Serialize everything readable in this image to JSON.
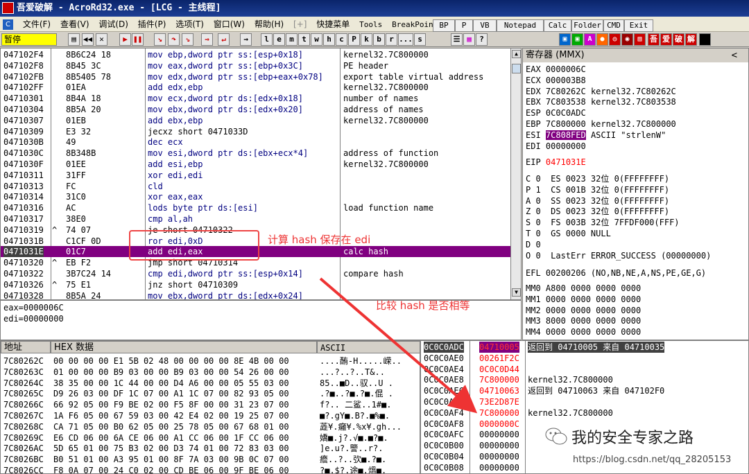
{
  "title": "吾爱破解 - AcroRd32.exe - [LCG - 主线程]",
  "menu": [
    "文件(F)",
    "查看(V)",
    "调试(D)",
    "插件(P)",
    "选项(T)",
    "窗口(W)",
    "帮助(H)",
    "[+]",
    "快捷菜单",
    "Tools",
    "BreakPoint->"
  ],
  "menu_buttons": [
    "BP",
    "P",
    "VB",
    "Notepad",
    "Calc",
    "Folder",
    "CMD",
    "Exit"
  ],
  "status": "暂停",
  "toolbar_letters": [
    "l",
    "e",
    "m",
    "t",
    "w",
    "h",
    "c",
    "P",
    "k",
    "b",
    "r",
    "...",
    "s"
  ],
  "toolbar_right": [
    "吾",
    "爱",
    "破",
    "解"
  ],
  "disasm": [
    {
      "addr": "047102F4",
      "bytes": "8B6C24 18",
      "arrow": "",
      "instr": "mov ebp,dword ptr ss:[esp+0x18]",
      "comment": "kernel32.7C800000",
      "kind": "normal"
    },
    {
      "addr": "047102F8",
      "bytes": "8B45 3C",
      "arrow": "",
      "instr": "mov eax,dword ptr ss:[ebp+0x3C]",
      "comment": "PE header",
      "kind": "normal"
    },
    {
      "addr": "047102FB",
      "bytes": "8B5405 78",
      "arrow": "",
      "instr": "mov edx,dword ptr ss:[ebp+eax+0x78]",
      "comment": "export table virtual address",
      "kind": "normal"
    },
    {
      "addr": "047102FF",
      "bytes": "01EA",
      "arrow": "",
      "instr": "add edx,ebp",
      "comment": "kernel32.7C800000",
      "kind": "normal"
    },
    {
      "addr": "04710301",
      "bytes": "8B4A 18",
      "arrow": "",
      "instr": "mov ecx,dword ptr ds:[edx+0x18]",
      "comment": "number of names",
      "kind": "normal"
    },
    {
      "addr": "04710304",
      "bytes": "8B5A 20",
      "arrow": "",
      "instr": "mov ebx,dword ptr ds:[edx+0x20]",
      "comment": "address of names",
      "kind": "normal"
    },
    {
      "addr": "04710307",
      "bytes": "01EB",
      "arrow": "",
      "instr": "add ebx,ebp",
      "comment": "kernel32.7C800000",
      "kind": "normal"
    },
    {
      "addr": "04710309",
      "bytes": "E3 32",
      "arrow": "",
      "instr": "jecxz short 0471033D",
      "comment": "",
      "kind": "jmp"
    },
    {
      "addr": "0471030B",
      "bytes": "49",
      "arrow": "",
      "instr": "dec ecx",
      "comment": "",
      "kind": "normal"
    },
    {
      "addr": "0471030C",
      "bytes": "8B348B",
      "arrow": "",
      "instr": "mov esi,dword ptr ds:[ebx+ecx*4]",
      "comment": "address of function",
      "kind": "normal"
    },
    {
      "addr": "0471030F",
      "bytes": "01EE",
      "arrow": "",
      "instr": "add esi,ebp",
      "comment": "kernel32.7C800000",
      "kind": "normal"
    },
    {
      "addr": "04710311",
      "bytes": "31FF",
      "arrow": "",
      "instr": "xor edi,edi",
      "comment": "",
      "kind": "normal"
    },
    {
      "addr": "04710313",
      "bytes": "FC",
      "arrow": "",
      "instr": "cld",
      "comment": "",
      "kind": "normal"
    },
    {
      "addr": "04710314",
      "bytes": "31C0",
      "arrow": "",
      "instr": "xor eax,eax",
      "comment": "",
      "kind": "normal"
    },
    {
      "addr": "04710316",
      "bytes": "AC",
      "arrow": "",
      "instr": "lods byte ptr ds:[esi]",
      "comment": "load function name",
      "kind": "normal"
    },
    {
      "addr": "04710317",
      "bytes": "38E0",
      "arrow": "",
      "instr": "cmp al,ah",
      "comment": "",
      "kind": "normal"
    },
    {
      "addr": "04710319",
      "bytes": "74 07",
      "arrow": "^",
      "instr": "je short 04710322",
      "comment": "",
      "kind": "jmp"
    },
    {
      "addr": "0471031B",
      "bytes": "C1CF 0D",
      "arrow": "",
      "instr": "ror edi,0xD",
      "comment": "",
      "kind": "normal"
    },
    {
      "addr": "0471031E",
      "bytes": "01C7",
      "arrow": "",
      "instr": "add edi,eax",
      "comment": "calc hash",
      "kind": "current"
    },
    {
      "addr": "04710320",
      "bytes": "EB F2",
      "arrow": "^",
      "instr": "jmp short 04710314",
      "comment": "",
      "kind": "jmp"
    },
    {
      "addr": "04710322",
      "bytes": "3B7C24 14",
      "arrow": "",
      "instr": "cmp edi,dword ptr ss:[esp+0x14]",
      "comment": "compare hash",
      "kind": "normal"
    },
    {
      "addr": "04710326",
      "bytes": "75 E1",
      "arrow": "^",
      "instr": "jnz short 04710309",
      "comment": "",
      "kind": "jmp"
    },
    {
      "addr": "04710328",
      "bytes": "8B5A 24",
      "arrow": "",
      "instr": "mov ebx,dword ptr ds:[edx+0x24]",
      "comment": "",
      "kind": "normal"
    }
  ],
  "info": [
    "eax=0000006C",
    "edi=00000000"
  ],
  "regs_header": "寄存器 (MMX)",
  "regs": [
    {
      "name": "EAX",
      "val": "0000006C",
      "extra": ""
    },
    {
      "name": "ECX",
      "val": "000003B8",
      "extra": ""
    },
    {
      "name": "EDX",
      "val": "7C80262C",
      "extra": "kernel32.7C80262C"
    },
    {
      "name": "EBX",
      "val": "7C803538",
      "extra": "kernel32.7C803538"
    },
    {
      "name": "ESP",
      "val": "0C0C0ADC",
      "extra": ""
    },
    {
      "name": "EBP",
      "val": "7C800000",
      "extra": "kernel32.7C800000"
    },
    {
      "name": "ESI",
      "val": "7C808FED",
      "extra": "ASCII \"strlenW\""
    },
    {
      "name": "EDI",
      "val": "00000000",
      "extra": ""
    }
  ],
  "eip": {
    "name": "EIP",
    "val": "0471031E"
  },
  "flags": [
    "C 0  ES 0023 32位 0(FFFFFFFF)",
    "P 1  CS 001B 32位 0(FFFFFFFF)",
    "A 0  SS 0023 32位 0(FFFFFFFF)",
    "Z 0  DS 0023 32位 0(FFFFFFFF)",
    "S 0  FS 003B 32位 7FFDF000(FFF)",
    "T 0  GS 0000 NULL",
    "D 0",
    "O 0  LastErr ERROR_SUCCESS (00000000)"
  ],
  "efl": "EFL 00200206 (NO,NB,NE,A,NS,PE,GE,G)",
  "mmx": [
    "MM0 A800 0000 0000 0000",
    "MM1 0000 0000 0000 0000",
    "MM2 0000 0000 0000 0000",
    "MM3 8000 0000 0000 0000",
    "MM4 0000 0000 0000 0000"
  ],
  "dump_headers": {
    "addr": "地址",
    "hex": "HEX 数据",
    "ascii": "ASCII"
  },
  "dump": [
    {
      "addr": "7C80262C",
      "hex": "00 00 00 00 E1 5B 02 48 00 00 00 00 8E 4B 00 00",
      "ascii": "....酭-H.....嵘.."
    },
    {
      "addr": "7C80263C",
      "hex": "01 00 00 00 B9 03 00 00 B9 03 00 00 54 26 00 00",
      "ascii": "...?..?..T&.."
    },
    {
      "addr": "7C80264C",
      "hex": "38 35 00 00 1C 44 00 00 D4 A6 00 00 05 55 03 00",
      "ascii": "85..■D..驭..U ."
    },
    {
      "addr": "7C80265C",
      "hex": "D9 26 03 00 DF 1C 07 00 A1 1C 07 00 82 93 05 00",
      "ascii": ".?■..?■.?■.倱 ."
    },
    {
      "addr": "7C80266C",
      "hex": "66 92 05 00 F9 BE 02 00 F5 8F 00 00 31 23 07 00",
      "ascii": "f?.. 二鲨..1#■."
    },
    {
      "addr": "7C80267C",
      "hex": "1A F6 05 00 67 59 03 00 42 E4 02 00 19 25 07 00",
      "ascii": "■?.gY■.B?.■%■."
    },
    {
      "addr": "7C80268C",
      "hex": "CA 71 05 00 B0 62 05 00 25 78 05 00 67 68 01 00",
      "ascii": "蕋¥.癰¥.%x¥.gh..."
    },
    {
      "addr": "7C80269C",
      "hex": "E6 CD 06 00 6A CE 06 00 A1 CC 06 00 1F CC 06 00",
      "ascii": "嬌■.j?.√■.■?■."
    },
    {
      "addr": "7C8026AC",
      "hex": "5D 65 01 00 75 B3 02 00 D3 74 01 00 72 83 03 00",
      "ascii": "]e.u?.譼..r?."
    },
    {
      "addr": "7C8026BC",
      "hex": "B0 51 01 00 A3 95 01 00 8F 7A 03 00 9B 0C 07 00",
      "ascii": "癚..?..弞■.?■."
    },
    {
      "addr": "7C8026CC",
      "hex": "F8 0A 07 00 24 C0 02 00 CD BE 06 00 9F BE 06 00",
      "ascii": "?■.$?.途■.熅■."
    }
  ],
  "stack": [
    {
      "addr": "0C0C0ADC",
      "val": "04710005",
      "comment": "返回到 04710005 来自 04710035",
      "kind": "sel"
    },
    {
      "addr": "0C0C0AE0",
      "val": "00261F2C",
      "comment": "",
      "kind": "red"
    },
    {
      "addr": "0C0C0AE4",
      "val": "0C0C0D44",
      "comment": "",
      "kind": "red"
    },
    {
      "addr": "0C0C0AE8",
      "val": "7C800000",
      "comment": "kernel32.7C800000",
      "kind": "red"
    },
    {
      "addr": "0C0C0AEC",
      "val": "04710063",
      "comment": "返回到 04710063 来自 047102F0",
      "kind": "red"
    },
    {
      "addr": "0C0C0AF0",
      "val": "73E2D87E",
      "comment": "",
      "kind": "red"
    },
    {
      "addr": "0C0C0AF4",
      "val": "7C800000",
      "comment": "kernel32.7C800000",
      "kind": "red"
    },
    {
      "addr": "0C0C0AF8",
      "val": "0000000C",
      "comment": "",
      "kind": "red"
    },
    {
      "addr": "0C0C0AFC",
      "val": "00000000",
      "comment": "",
      "kind": "normal"
    },
    {
      "addr": "0C0C0B00",
      "val": "00000000",
      "comment": "",
      "kind": "normal"
    },
    {
      "addr": "0C0C0B04",
      "val": "00000000",
      "comment": "",
      "kind": "normal"
    },
    {
      "addr": "0C0C0B08",
      "val": "00000000",
      "comment": "",
      "kind": "normal"
    }
  ],
  "annotations": {
    "calc": "计算 hash 保存在 edi",
    "compare": "比较 hash 是否相等"
  },
  "watermark": {
    "name": "我的安全专家之路",
    "url": "https://blog.csdn.net/qq_28205153"
  }
}
